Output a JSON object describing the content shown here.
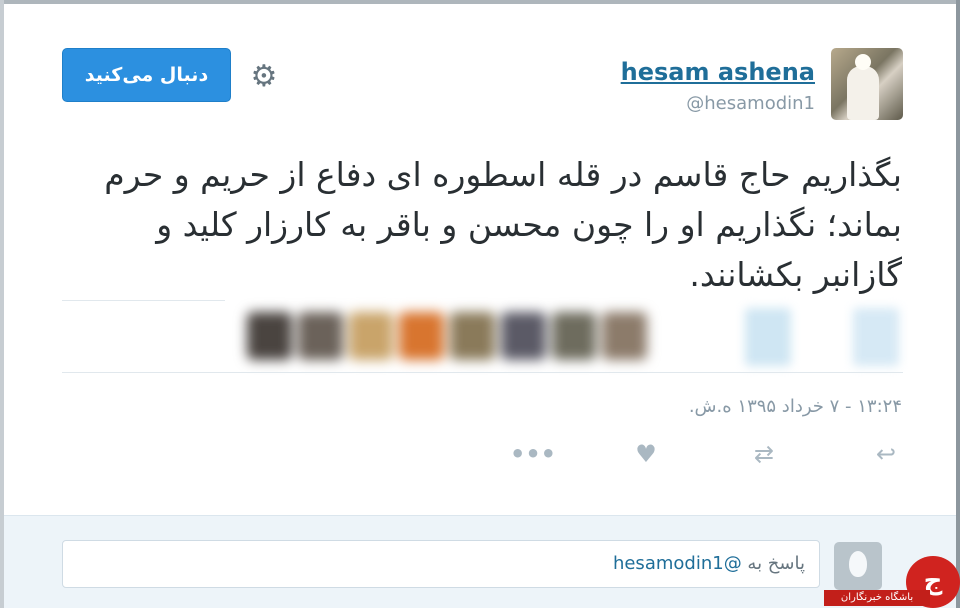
{
  "header": {
    "follow_label": "دنبال می‌کنید",
    "user_name": "hesam ashena",
    "user_handle": "@hesamodin1"
  },
  "icons": {
    "settings": "gear-icon",
    "reply": "reply-icon",
    "retweet": "retweet-icon",
    "like": "heart-icon",
    "more": "more-icon"
  },
  "tweet": {
    "text": "بگذاریم حاج قاسم در قله اسطوره ای دفاع از حریم و حرم بماند؛ نگذاریم او را چون محسن و باقر به کارزار کلید و گازانبر بکشانند.",
    "timestamp": "۱۳:۲۴ - ۷ خرداد ۱۳۹۵ ه.ش."
  },
  "actions": {
    "reply_glyph": "↩",
    "retweet_glyph": "⇄",
    "like_glyph": "♥",
    "more_glyph": "•••"
  },
  "reply_box": {
    "prefix": "پاسخ به",
    "mention": "@hesamodin1"
  },
  "watermark": {
    "logo_glyph": "ج",
    "caption": "باشگاه خبرنگاران"
  },
  "colors": {
    "accent": "#2c90e0",
    "link": "#1f6e99",
    "muted": "#8899a6",
    "text": "#292f33",
    "reply_bg": "#edf4f9"
  },
  "blurred_faces": [
    "#4a4440",
    "#6b625a",
    "#c9a46a",
    "#d8752f",
    "#8a7a5a",
    "#5b5a66",
    "#6e6c5e",
    "#8c7b6a"
  ]
}
